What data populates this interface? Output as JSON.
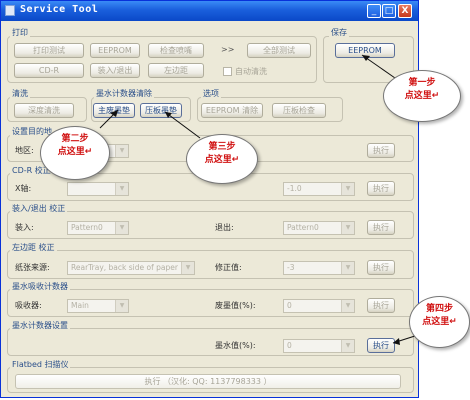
{
  "window": {
    "title": "Service Tool",
    "controls": {
      "minimize": "_",
      "maximize": "□",
      "close": "X"
    }
  },
  "print_group": {
    "label": "打印",
    "buttons": [
      "打印测试",
      "EEPROM",
      "检查喷嘴",
      "全部测试",
      "CD-R",
      "装入/退出",
      "左边距"
    ],
    "arrow": ">>",
    "auto_clean_label": "自动清洗"
  },
  "save_group": {
    "label": "保存",
    "eeprom_button": "EEPROM"
  },
  "clean_group": {
    "label": "清洗",
    "deep_clean_button": "深度清洗"
  },
  "ink_reset_group": {
    "label": "墨水计数器清除",
    "main_pad_button": "主废墨垫",
    "platen_pad_button": "压板墨垫"
  },
  "options_group": {
    "label": "选项",
    "eeprom_clear_button": "EEPROM 清除",
    "platen_check_button": "压板检查"
  },
  "dest_group": {
    "label": "设置目的地",
    "region_label": "地区:",
    "execute": "执行"
  },
  "cdr_group": {
    "label": "CD-R 校正",
    "x_label": "X轴:",
    "value": "-1.0",
    "execute": "执行"
  },
  "load_group": {
    "label": "装入/退出 校正",
    "load_label": "装入:",
    "load_value": "Pattern0",
    "eject_label": "退出:",
    "eject_value": "Pattern0",
    "execute": "执行"
  },
  "margin_group": {
    "label": "左边距 校正",
    "source_label": "纸张来源:",
    "source_value": "RearTray, back side of paper",
    "correction_label": "修正值:",
    "correction_value": "-3",
    "execute": "执行"
  },
  "ink_absorb_group": {
    "label": "墨水吸收计数器",
    "absorber_label": "吸收器:",
    "absorber_value": "Main",
    "waste_label": "废墨值(%):",
    "waste_value": "0",
    "execute": "执行"
  },
  "ink_counter_group": {
    "label": "墨水计数器设置",
    "ink_label": "墨水值(%):",
    "ink_value": "0",
    "execute": "执行"
  },
  "flatbed_group": {
    "label": "Flatbed 扫描仪",
    "execute_text": "执行  （汉化: QQ: 1137798333 ）"
  },
  "annotations": [
    {
      "line1": "第一步",
      "line2": "点这里↵"
    },
    {
      "line1": "第二步",
      "line2": "点这里↵"
    },
    {
      "line1": "第三步",
      "line2": "点这里↵"
    },
    {
      "line1": "第四步",
      "line2": "点这里↵"
    }
  ],
  "colors": {
    "title_bar": "#1a5fdc",
    "window_bg": "#ece9d8",
    "annotation_text": "#d01010",
    "label_text": "#2a4f8a"
  }
}
